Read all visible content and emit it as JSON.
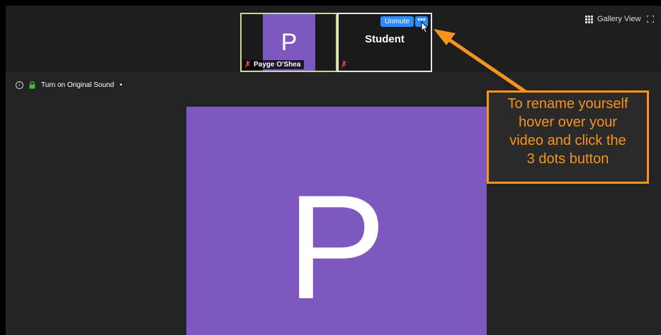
{
  "thumbnails": {
    "payge": {
      "avatar_letter": "P",
      "name": "Payge O'Shea"
    },
    "student": {
      "name": "Student",
      "unmute_label": "Unmute",
      "more_label": "•••"
    }
  },
  "toolbar": {
    "gallery_view_label": "Gallery View"
  },
  "sound": {
    "label": "Turn on Original Sound",
    "dropdown": "•"
  },
  "main": {
    "avatar_letter": "P"
  },
  "callout": {
    "lines": [
      "To rename yourself",
      "hover over your",
      "video and click the",
      "3 dots button"
    ]
  },
  "colors": {
    "avatar": "#7d58c0",
    "accent": "#2d8cff",
    "callout": "#f7941d"
  }
}
